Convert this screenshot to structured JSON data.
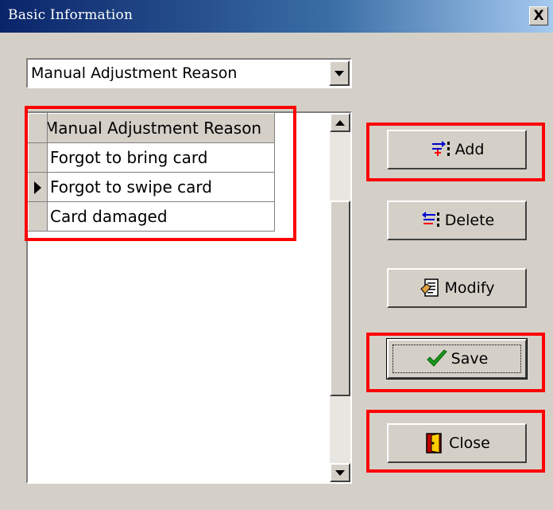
{
  "window": {
    "title": "Basic Information",
    "close_label": "X"
  },
  "category_select": {
    "value": "Manual Adjustment Reason"
  },
  "grid": {
    "header": "Manual Adjustment Reason",
    "rows": [
      "Forgot to bring card",
      "Forgot to swipe card",
      "Card damaged"
    ],
    "current_row": "Forgot to swipe card"
  },
  "buttons": {
    "add": "Add",
    "delete": "Delete",
    "modify": "Modify",
    "save": "Save",
    "close": "Close"
  },
  "icons": [
    "add-record-icon",
    "delete-record-icon",
    "modify-record-icon",
    "save-checkmark-icon",
    "close-door-icon"
  ],
  "colors": {
    "highlight": "#ff0000",
    "titlebar": "#0a246a",
    "face": "#d4d0c8"
  }
}
